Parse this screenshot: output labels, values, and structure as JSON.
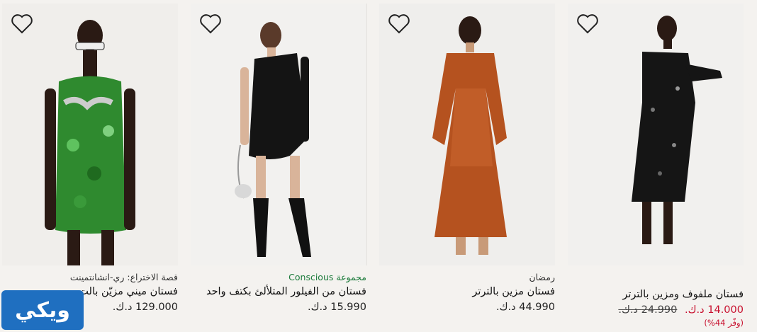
{
  "products": [
    {
      "tag": "فستان ملفوف ومزين بالترتر",
      "title": "",
      "price": "14.000 د.ك.",
      "old_price": "24.990 د.ك.",
      "save": "(وفّر 44%)"
    },
    {
      "tag": "رمضان",
      "title": "فستان مزين بالترتر",
      "price": "44.990 د.ك."
    },
    {
      "tag": "مجموعة Conscious",
      "title": "فستان من الفيلور المتلألئ بكتف واحد",
      "price": "15.990 د.ك."
    },
    {
      "tag": "قصة الاختراع: ري-انشانتمينت",
      "title": "فستان ميني مزيّن بالت",
      "price": "129.000 د.ك."
    }
  ],
  "logo": {
    "text": "ويكي"
  },
  "colors": {
    "sale": "#c8102e",
    "conscious": "#1b7a3a",
    "logo_bg": "#1f6fc0"
  },
  "icons": [
    "heart-icon"
  ]
}
